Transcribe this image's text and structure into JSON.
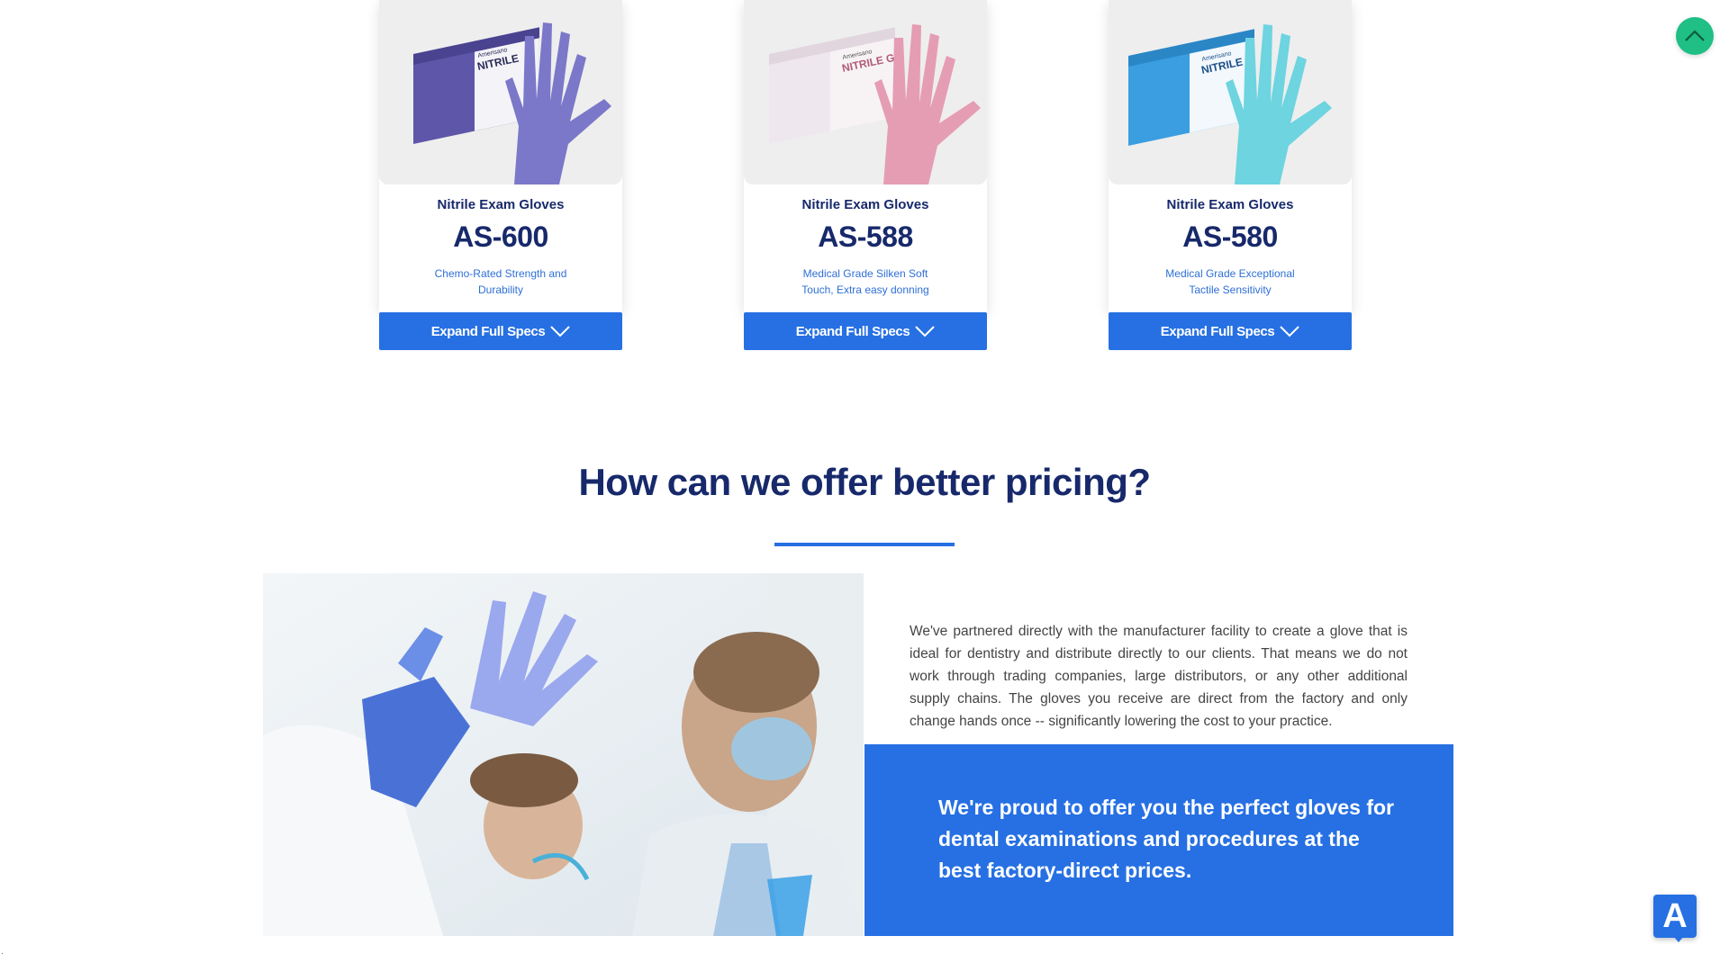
{
  "products": [
    {
      "category": "Nitrile Exam Gloves",
      "code": "AS-600",
      "description": "Chemo-Rated Strength and Durability",
      "button_label": "Expand Full Specs",
      "box_brand": "Amerisano",
      "box_label": "NITRILE",
      "box_color": "#5e56a8",
      "glove_color": "#7b78c9"
    },
    {
      "category": "Nitrile Exam Gloves",
      "code": "AS-588",
      "description": "Medical Grade Silken Soft Touch, Extra easy donning",
      "button_label": "Expand Full Specs",
      "box_brand": "Amerisano",
      "box_label": "NITRILE G",
      "box_color": "#efe7ee",
      "glove_color": "#e59db4"
    },
    {
      "category": "Nitrile Exam Gloves",
      "code": "AS-580",
      "description": "Medical Grade Exceptional Tactile Sensitivity",
      "button_label": "Expand Full Specs",
      "box_brand": "Amerisano",
      "box_label": "NITRILE",
      "box_color": "#3a9ee0",
      "glove_color": "#6dd4e0"
    }
  ],
  "section": {
    "title": "How can we offer better pricing?",
    "body": "We've partnered directly with the manufacturer facility to create a glove that is ideal for dentistry and distribute directly to our clients. That means we do not work through trading companies, large distributors, or any other additional supply chains. The gloves you receive are direct from the factory and only change hands once -- significantly lowering the cost to your practice.",
    "callout": "We're proud to offer you the perfect gloves for dental examinations and procedures at the best factory-direct prices."
  },
  "widgets": {
    "back_to_top_icon": "chevron-up-icon",
    "accessibility_letter": "A",
    "corner_mark": "."
  },
  "colors": {
    "brand_blue": "#2670e3",
    "navy": "#17296b",
    "teal": "#1fbf86"
  }
}
